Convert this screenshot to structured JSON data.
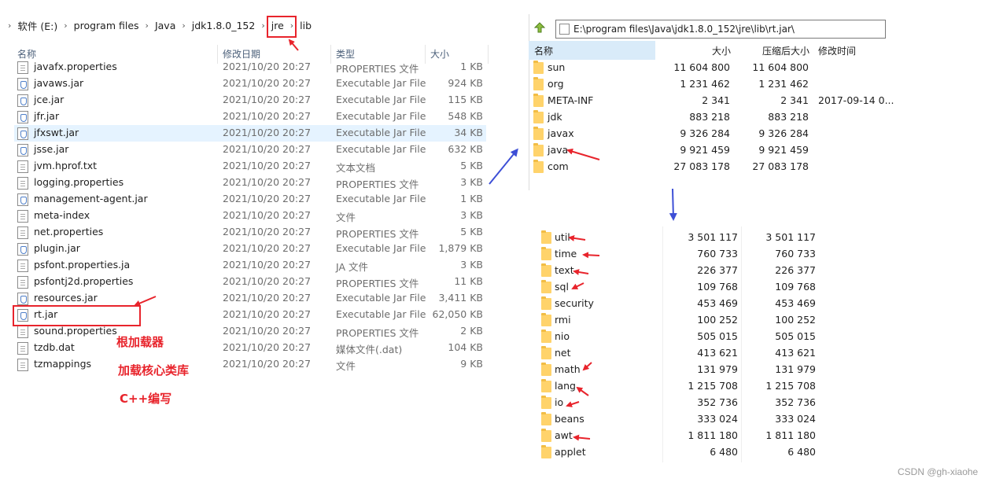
{
  "explorer": {
    "breadcrumb": [
      "软件 (E:)",
      "program files",
      "Java",
      "jdk1.8.0_152",
      "jre",
      "lib"
    ],
    "columns": {
      "name": "名称",
      "date": "修改日期",
      "type": "类型",
      "size": "大小"
    },
    "rows": [
      {
        "name": "javafx.properties",
        "date": "2021/10/20 20:27",
        "type": "PROPERTIES 文件",
        "size": "1 KB",
        "icon": "plain-file-icon"
      },
      {
        "name": "javaws.jar",
        "date": "2021/10/20 20:27",
        "type": "Executable Jar File",
        "size": "924 KB",
        "icon": "jar-file-icon"
      },
      {
        "name": "jce.jar",
        "date": "2021/10/20 20:27",
        "type": "Executable Jar File",
        "size": "115 KB",
        "icon": "jar-file-icon"
      },
      {
        "name": "jfr.jar",
        "date": "2021/10/20 20:27",
        "type": "Executable Jar File",
        "size": "548 KB",
        "icon": "jar-file-icon"
      },
      {
        "name": "jfxswt.jar",
        "date": "2021/10/20 20:27",
        "type": "Executable Jar File",
        "size": "34 KB",
        "icon": "jar-file-icon"
      },
      {
        "name": "jsse.jar",
        "date": "2021/10/20 20:27",
        "type": "Executable Jar File",
        "size": "632 KB",
        "icon": "jar-file-icon"
      },
      {
        "name": "jvm.hprof.txt",
        "date": "2021/10/20 20:27",
        "type": "文本文档",
        "size": "5 KB",
        "icon": "plain-file-icon"
      },
      {
        "name": "logging.properties",
        "date": "2021/10/20 20:27",
        "type": "PROPERTIES 文件",
        "size": "3 KB",
        "icon": "plain-file-icon"
      },
      {
        "name": "management-agent.jar",
        "date": "2021/10/20 20:27",
        "type": "Executable Jar File",
        "size": "1 KB",
        "icon": "jar-file-icon"
      },
      {
        "name": "meta-index",
        "date": "2021/10/20 20:27",
        "type": "文件",
        "size": "3 KB",
        "icon": "plain-file-icon"
      },
      {
        "name": "net.properties",
        "date": "2021/10/20 20:27",
        "type": "PROPERTIES 文件",
        "size": "5 KB",
        "icon": "plain-file-icon"
      },
      {
        "name": "plugin.jar",
        "date": "2021/10/20 20:27",
        "type": "Executable Jar File",
        "size": "1,879 KB",
        "icon": "jar-file-icon"
      },
      {
        "name": "psfont.properties.ja",
        "date": "2021/10/20 20:27",
        "type": "JA 文件",
        "size": "3 KB",
        "icon": "plain-file-icon"
      },
      {
        "name": "psfontj2d.properties",
        "date": "2021/10/20 20:27",
        "type": "PROPERTIES 文件",
        "size": "11 KB",
        "icon": "plain-file-icon"
      },
      {
        "name": "resources.jar",
        "date": "2021/10/20 20:27",
        "type": "Executable Jar File",
        "size": "3,411 KB",
        "icon": "jar-file-icon"
      },
      {
        "name": "rt.jar",
        "date": "2021/10/20 20:27",
        "type": "Executable Jar File",
        "size": "62,050 KB",
        "icon": "jar-file-icon"
      },
      {
        "name": "sound.properties",
        "date": "2021/10/20 20:27",
        "type": "PROPERTIES 文件",
        "size": "2 KB",
        "icon": "plain-file-icon"
      },
      {
        "name": "tzdb.dat",
        "date": "2021/10/20 20:27",
        "type": "媒体文件(.dat)",
        "size": "104 KB",
        "icon": "plain-file-icon"
      },
      {
        "name": "tzmappings",
        "date": "2021/10/20 20:27",
        "type": "文件",
        "size": "9 KB",
        "icon": "plain-file-icon"
      }
    ],
    "selected_row": "jfxswt.jar"
  },
  "archive": {
    "address": "E:\\program files\\Java\\jdk1.8.0_152\\jre\\lib\\rt.jar\\",
    "columns": {
      "name": "名称",
      "size": "大小",
      "packed": "压缩后大小",
      "modified": "修改时间"
    },
    "rows": [
      {
        "name": "sun",
        "size": "11 604 800",
        "packed": "11 604 800",
        "modified": ""
      },
      {
        "name": "org",
        "size": "1 231 462",
        "packed": "1 231 462",
        "modified": ""
      },
      {
        "name": "META-INF",
        "size": "2 341",
        "packed": "2 341",
        "modified": "2017-09-14 0..."
      },
      {
        "name": "jdk",
        "size": "883 218",
        "packed": "883 218",
        "modified": ""
      },
      {
        "name": "javax",
        "size": "9 326 284",
        "packed": "9 326 284",
        "modified": ""
      },
      {
        "name": "java",
        "size": "9 921 459",
        "packed": "9 921 459",
        "modified": ""
      },
      {
        "name": "com",
        "size": "27 083 178",
        "packed": "27 083 178",
        "modified": ""
      }
    ]
  },
  "packages": {
    "rows": [
      {
        "name": "util",
        "size": "3 501 117",
        "packed": "3 501 117"
      },
      {
        "name": "time",
        "size": "760 733",
        "packed": "760 733"
      },
      {
        "name": "text",
        "size": "226 377",
        "packed": "226 377"
      },
      {
        "name": "sql",
        "size": "109 768",
        "packed": "109 768"
      },
      {
        "name": "security",
        "size": "453 469",
        "packed": "453 469"
      },
      {
        "name": "rmi",
        "size": "100 252",
        "packed": "100 252"
      },
      {
        "name": "nio",
        "size": "505 015",
        "packed": "505 015"
      },
      {
        "name": "net",
        "size": "413 621",
        "packed": "413 621"
      },
      {
        "name": "math",
        "size": "131 979",
        "packed": "131 979"
      },
      {
        "name": "lang",
        "size": "1 215 708",
        "packed": "1 215 708"
      },
      {
        "name": "io",
        "size": "352 736",
        "packed": "352 736"
      },
      {
        "name": "beans",
        "size": "333 024",
        "packed": "333 024"
      },
      {
        "name": "awt",
        "size": "1 811 180",
        "packed": "1 811 180"
      },
      {
        "name": "applet",
        "size": "6 480",
        "packed": "6 480"
      }
    ]
  },
  "annotations": {
    "note1": "根加载器",
    "note2": "加载核心类库",
    "note3": "C++编写",
    "color": "#e8242c",
    "arrow_color": "#3d4fd6"
  },
  "watermark": "CSDN @gh-xiaohe",
  "colors": {
    "selection": "#e5f3ff",
    "header_text": "#4c607a",
    "folder": "#ffd36b"
  }
}
